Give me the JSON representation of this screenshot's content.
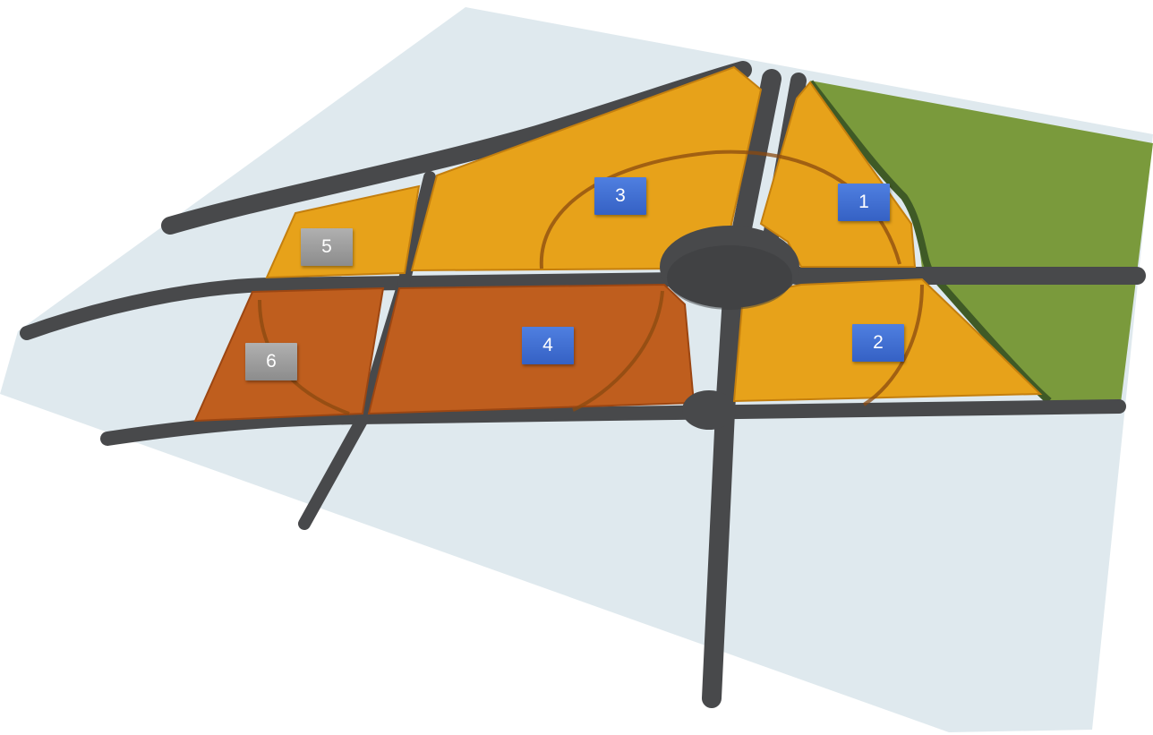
{
  "colors": {
    "ground": "#dfe9ee",
    "road": "#48494b",
    "parcel_light": "#e7a21a",
    "parcel_dark": "#bf5e1e",
    "park": "#7a9a3c",
    "label_blue": "#3f6fd3",
    "label_grey": "#9c9c9c"
  },
  "parcels": [
    {
      "id": "1",
      "label": "1",
      "status": "blue",
      "zone": "light-orange"
    },
    {
      "id": "2",
      "label": "2",
      "status": "blue",
      "zone": "light-orange"
    },
    {
      "id": "3",
      "label": "3",
      "status": "blue",
      "zone": "light-orange"
    },
    {
      "id": "4",
      "label": "4",
      "status": "blue",
      "zone": "dark-orange"
    },
    {
      "id": "5",
      "label": "5",
      "status": "grey",
      "zone": "light-orange"
    },
    {
      "id": "6",
      "label": "6",
      "status": "grey",
      "zone": "dark-orange"
    }
  ]
}
